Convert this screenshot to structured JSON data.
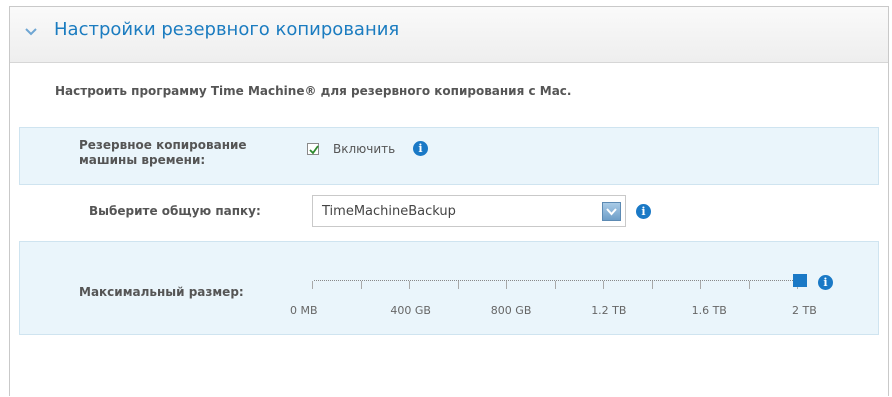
{
  "header": {
    "title": "Настройки резервного копирования"
  },
  "description": "Настроить программу Time Machine® для резервного копирования с Mac.",
  "backup": {
    "label_line1": "Резервное копирование",
    "label_line2": "машины времени:",
    "checkbox_label": "Включить",
    "enabled": true
  },
  "share": {
    "label": "Выберите общую папку:",
    "selected": "TimeMachineBackup"
  },
  "max_size": {
    "label": "Максимальный размер:",
    "scale_labels": [
      "0 MB",
      "400 GB",
      "800 GB",
      "1.2 TB",
      "1.6 TB",
      "2 TB"
    ],
    "value_fraction": 1.0
  },
  "colors": {
    "accent": "#1a79c6",
    "title": "#1b7cc0",
    "band": "#eaf5fb"
  },
  "icons": {
    "collapse": "chevron-down-icon",
    "info": "info-icon",
    "check": "check-icon",
    "dropdown": "dropdown-arrow-icon"
  }
}
